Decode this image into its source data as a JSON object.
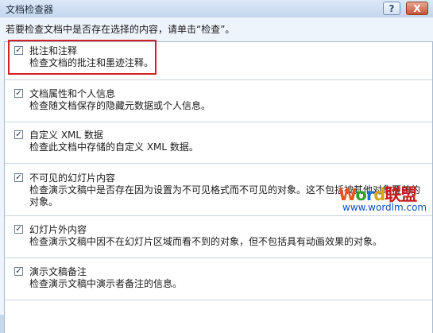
{
  "window": {
    "title": "文档检查器",
    "help_label": "?",
    "close_label": "X"
  },
  "instruction": "若要检查文档中是否存在选择的内容，请单击“检查”。",
  "items": [
    {
      "label": "批注和注释",
      "description": "检查文档的批注和墨迹注释。",
      "checked": true
    },
    {
      "label": "文档属性和个人信息",
      "description": "检查随文档保存的隐藏元数据或个人信息。",
      "checked": true
    },
    {
      "label": "自定义 XML 数据",
      "description": "检查此文档中存储的自定义 XML 数据。",
      "checked": true
    },
    {
      "label": "不可见的幻灯片内容",
      "description": "检查演示文稿中是否存在因为设置为不可见格式而不可见的对象。这不包括被其他对象覆盖的对象。",
      "checked": true
    },
    {
      "label": "幻灯片外内容",
      "description": "检查演示文稿中因不在幻灯片区域而看不到的对象，但不包括具有动画效果的对象。",
      "checked": true
    },
    {
      "label": "演示文稿备注",
      "description": "检查演示文稿中演示者备注的信息。",
      "checked": true
    }
  ],
  "watermark": {
    "logo_latin": [
      "W",
      "o",
      "r",
      "d"
    ],
    "logo_cn": "联盟",
    "url": "www.wordlm.com"
  },
  "colors": {
    "highlight": "#d32222",
    "titlebar": "#c3d6ed",
    "close_button": "#c4543a"
  }
}
